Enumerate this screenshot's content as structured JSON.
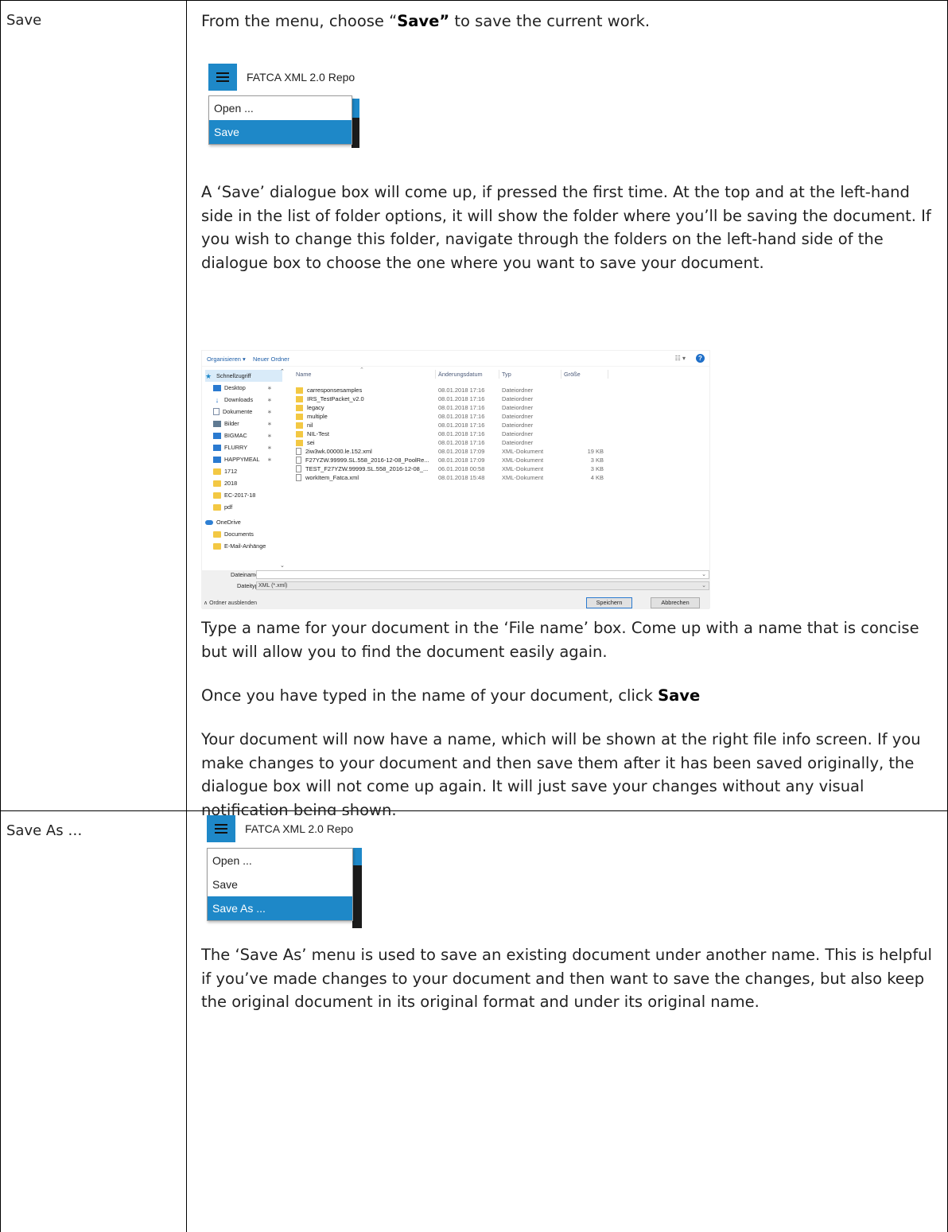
{
  "rows": [
    {
      "label": "Save"
    },
    {
      "label": "Save As …"
    }
  ],
  "save": {
    "intro_before": "From the menu, choose “",
    "intro_bold": "Save”",
    "intro_after": " to save the current work.",
    "menu": {
      "app_title": "FATCA XML 2.0 Repo",
      "items": [
        "Open ...",
        "Save"
      ],
      "active_index": 1
    },
    "dialog_text": "A ‘Save’ dialogue box will come up, if pressed the first time. At the top and at the left-hand side in the list of folder options, it will show the folder where you’ll be saving the document. If you wish to change this folder, navigate through the folders on the left-hand side of the dialogue box to choose the one where you want to save your document.",
    "file_dialog": {
      "toolbar": {
        "organize": "Organisieren ▾",
        "new_folder": "Neuer Ordner",
        "view": "☷ ▾",
        "help": "?"
      },
      "nav": [
        {
          "label": "Schnellzugriff",
          "icon": "star",
          "pinned": false
        },
        {
          "label": "Desktop",
          "icon": "monitor",
          "pinned": true
        },
        {
          "label": "Downloads",
          "icon": "down",
          "pinned": true
        },
        {
          "label": "Dokumente",
          "icon": "doc",
          "pinned": true
        },
        {
          "label": "Bilder",
          "icon": "img",
          "pinned": true
        },
        {
          "label": "BIGMAC",
          "icon": "monitor",
          "pinned": true
        },
        {
          "label": "FLURRY",
          "icon": "monitor",
          "pinned": true
        },
        {
          "label": "HAPPYMEAL",
          "icon": "monitor",
          "pinned": true
        },
        {
          "label": "1712",
          "icon": "folder",
          "pinned": false
        },
        {
          "label": "2018",
          "icon": "folder",
          "pinned": false
        },
        {
          "label": "EC-2017-18",
          "icon": "folder",
          "pinned": false
        },
        {
          "label": "pdf",
          "icon": "folder",
          "pinned": false
        },
        {
          "label": "OneDrive",
          "icon": "cloud",
          "pinned": false
        },
        {
          "label": "Documents",
          "icon": "folder",
          "pinned": false
        },
        {
          "label": "E-Mail-Anhänge",
          "icon": "folder",
          "pinned": false
        }
      ],
      "columns": [
        "Name",
        "Änderungsdatum",
        "Typ",
        "Größe"
      ],
      "files": [
        {
          "name": "carresponsesamples",
          "date": "08.01.2018 17:16",
          "type": "Dateiordner",
          "size": "",
          "kind": "folder"
        },
        {
          "name": "IRS_TestPacket_v2.0",
          "date": "08.01.2018 17:16",
          "type": "Dateiordner",
          "size": "",
          "kind": "folder"
        },
        {
          "name": "legacy",
          "date": "08.01.2018 17:16",
          "type": "Dateiordner",
          "size": "",
          "kind": "folder"
        },
        {
          "name": "multiple",
          "date": "08.01.2018 17:16",
          "type": "Dateiordner",
          "size": "",
          "kind": "folder"
        },
        {
          "name": "nil",
          "date": "08.01.2018 17:16",
          "type": "Dateiordner",
          "size": "",
          "kind": "folder"
        },
        {
          "name": "NIL-Test",
          "date": "08.01.2018 17:16",
          "type": "Dateiordner",
          "size": "",
          "kind": "folder"
        },
        {
          "name": "sei",
          "date": "08.01.2018 17:16",
          "type": "Dateiordner",
          "size": "",
          "kind": "folder"
        },
        {
          "name": "2iw3wk.00000.le.152.xml",
          "date": "08.01.2018 17:09",
          "type": "XML-Dokument",
          "size": "19 KB",
          "kind": "xml"
        },
        {
          "name": "F27YZW.99999.SL.558_2016-12-08_PoolRe...",
          "date": "08.01.2018 17:09",
          "type": "XML-Dokument",
          "size": "3 KB",
          "kind": "xml"
        },
        {
          "name": "TEST_F27YZW.99999.SL.558_2016-12-08_...",
          "date": "06.01.2018 00:58",
          "type": "XML-Dokument",
          "size": "3 KB",
          "kind": "xml"
        },
        {
          "name": "workItem_Fatca.xml",
          "date": "08.01.2018 15:48",
          "type": "XML-Dokument",
          "size": "4 KB",
          "kind": "xml"
        }
      ],
      "filename_label": "Dateiname:",
      "filename_value": "",
      "filetype_label": "Dateityp:",
      "filetype_value": "XML (*.xml)",
      "hide_folders": "∧  Ordner ausblenden",
      "save_btn": "Speichern",
      "cancel_btn": "Abbrechen"
    },
    "type_name_text": "Type a name for your document in the ‘File name’ box. Come up with a name that is concise but will allow you to find the document easily again.",
    "click_save_before": "Once you have typed in the name of your document, click ",
    "click_save_bold": "Save",
    "result_text": "Your document will now have a name, which will be shown at the right file info screen. If you make changes to your document and then save them after it has been saved originally, the dialogue box will not come up again. It will just save your changes without any visual notification being shown."
  },
  "save_as": {
    "menu": {
      "app_title": "FATCA XML 2.0 Repo",
      "items": [
        "Open ...",
        "Save",
        "Save As ..."
      ],
      "active_index": 2
    },
    "text": "The ‘Save As’ menu is used to save an existing document under another name. This is helpful if you’ve made changes to your document and then want to save the changes, but also keep the original document in its original format and under its original name."
  }
}
